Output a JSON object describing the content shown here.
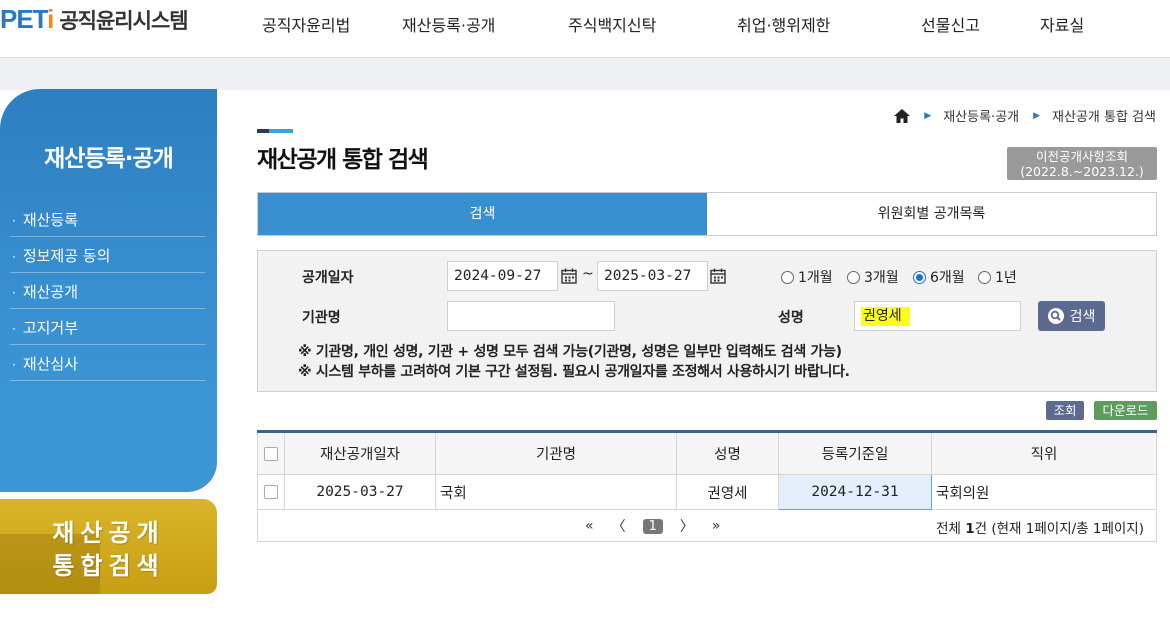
{
  "header": {
    "logo_mark_a": "PET",
    "logo_mark_b": "i",
    "logo_text": "공직윤리시스템",
    "nav": [
      "공직자윤리법",
      "재산등록·공개",
      "주식백지신탁",
      "취업·행위제한",
      "선물신고",
      "자료실"
    ]
  },
  "sidebar": {
    "title": "재산등록·공개",
    "items": [
      "재산등록",
      "정보제공 동의",
      "재산공개",
      "고지거부",
      "재산심사"
    ],
    "promo_line1": "재산공개",
    "promo_line2": "통합검색"
  },
  "breadcrumb": {
    "items": [
      "재산등록·공개",
      "재산공개 통합 검색"
    ]
  },
  "page": {
    "title": "재산공개 통합 검색",
    "prev_button_line1": "이전공개사항조회",
    "prev_button_line2": "(2022.8.~2023.12.)"
  },
  "tabs": [
    {
      "label": "검색",
      "active": true
    },
    {
      "label": "위원회별 공개목록",
      "active": false
    }
  ],
  "search": {
    "date_label": "공개일자",
    "date_from": "2024-09-27",
    "date_to": "2025-03-27",
    "tilde": "~",
    "periods": [
      {
        "label": "1개월",
        "checked": false
      },
      {
        "label": "3개월",
        "checked": false
      },
      {
        "label": "6개월",
        "checked": true
      },
      {
        "label": "1년",
        "checked": false
      }
    ],
    "org_label": "기관명",
    "org_value": "",
    "name_label": "성명",
    "name_value": "권영세",
    "search_button": "검색",
    "note1": "※ 기관명, 개인 성명, 기관 + 성명 모두 검색 가능(기관명, 성명은 일부만 입력해도 검색 가능)",
    "note2": "※ 시스템 부하를 고려하여 기본 구간 설정됨. 필요시 공개일자를 조정해서 사용하시기 바랍니다."
  },
  "actions": {
    "view": "조회",
    "download": "다운로드"
  },
  "table": {
    "headers": [
      "재산공개일자",
      "기관명",
      "성명",
      "등록기준일",
      "직위"
    ],
    "rows": [
      {
        "date": "2025-03-27",
        "org": "국회",
        "name": "권영세",
        "reg_date": "2024-12-31",
        "position": "국회의원"
      }
    ]
  },
  "pagination": {
    "first": "«",
    "prev": "〈",
    "current": "1",
    "next": "〉",
    "last": "»",
    "total_prefix": "전체 ",
    "total_count": "1",
    "total_suffix": "건 (현재 1페이지/총 1페이지)"
  },
  "colors": {
    "primary_blue": "#3a8fd0",
    "sidebar_blue": "#2d7fc0",
    "promo_gold": "#d0a81e",
    "highlight": "#fffb1e",
    "button_navy": "#5b6a8e",
    "button_green": "#5e9c5e"
  }
}
